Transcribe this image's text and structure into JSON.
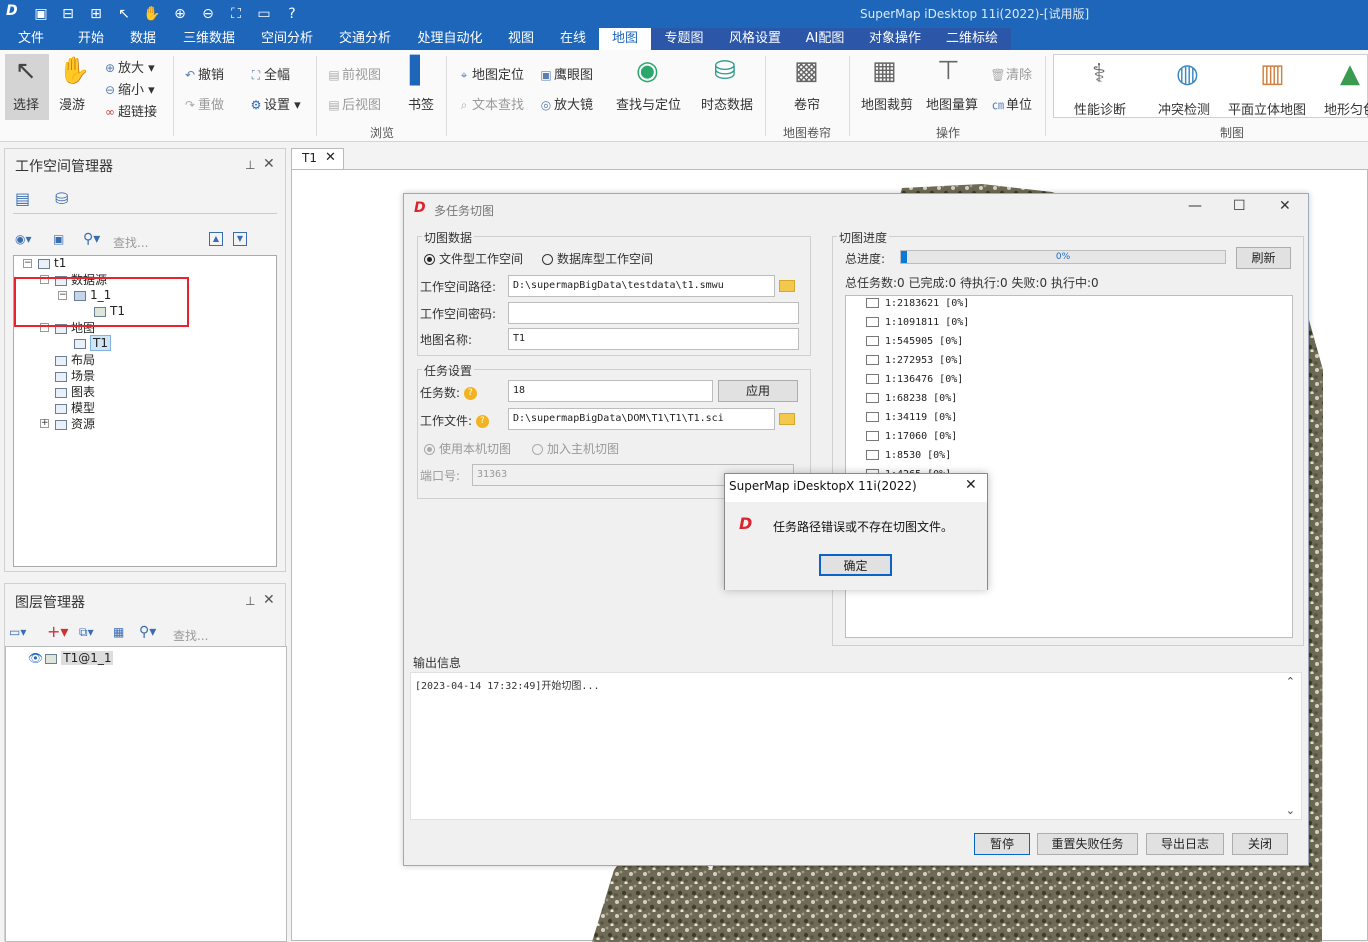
{
  "app": {
    "title": "SuperMap iDesktop 11i(2022)-[试用版]"
  },
  "menu": [
    "文件",
    "开始",
    "数据",
    "三维数据",
    "空间分析",
    "交通分析",
    "处理自动化",
    "视图",
    "在线",
    "地图",
    "专题图",
    "风格设置",
    "AI配图",
    "对象操作",
    "二维标绘"
  ],
  "ribbon": {
    "select": "选择",
    "pan": "漫游",
    "zoomin": "放大",
    "zoomout": "缩小",
    "hyperlink": "超链接",
    "undo": "撤销",
    "redo": "重做",
    "fullextent": "全幅",
    "settings": "设置",
    "prevview": "前视图",
    "nextview": "后视图",
    "bookmark": "书签",
    "maplocate": "地图定位",
    "eagleeye": "鹰眼图",
    "textfind": "文本查找",
    "magnifier": "放大镜",
    "findlocate": "查找与定位",
    "temporal": "时态数据",
    "swipe": "卷帘",
    "mapclip": "地图裁剪",
    "mapmeasure": "地图量算",
    "clear": "清除",
    "unit": "单位",
    "perfdiag": "性能诊断",
    "conflict": "冲突检测",
    "planar3d": "平面立体地图",
    "terrain": "地形匀色",
    "groups": {
      "browse": "浏览",
      "swipe": "地图卷帘",
      "operate": "操作",
      "draw": "制图"
    }
  },
  "workspace": {
    "title": "工作空间管理器",
    "search_placeholder": "查找...",
    "tree": {
      "root": "t1",
      "datasources": "数据源",
      "ds1": "1_1",
      "dataset": "T1",
      "maps": "地图",
      "map1": "T1",
      "layouts": "布局",
      "scenes": "场景",
      "charts": "图表",
      "models": "模型",
      "resources": "资源"
    }
  },
  "layers": {
    "title": "图层管理器",
    "search_placeholder": "查找...",
    "item": "T1@1_1"
  },
  "doc_tab": "T1",
  "dialog": {
    "title": "多任务切图",
    "tile_data": "切图数据",
    "file_ws": "文件型工作空间",
    "db_ws": "数据库型工作空间",
    "ws_path_label": "工作空间路径:",
    "ws_path": "D:\\supermapBigData\\testdata\\t1.smwu",
    "ws_pwd_label": "工作空间密码:",
    "map_name_label": "地图名称:",
    "map_name": "T1",
    "task_settings": "任务设置",
    "task_count_label": "任务数:",
    "task_count": "18",
    "apply": "应用",
    "work_file_label": "工作文件:",
    "work_file": "D:\\supermapBigData\\DOM\\T1\\T1\\T1.sci",
    "use_local": "使用本机切图",
    "join_master": "加入主机切图",
    "port_label": "端口号:",
    "port": "31363",
    "progress_title": "切图进度",
    "total_progress_label": "总进度:",
    "progress_value": 0.02,
    "progress_text": "0%",
    "refresh": "刷新",
    "stats": "总任务数:0 已完成:0 待执行:0 失败:0 执行中:0",
    "scales": [
      "1:2183621 [0%]",
      "1:1091811 [0%]",
      "1:545905 [0%]",
      "1:272953 [0%]",
      "1:136476 [0%]",
      "1:68238 [0%]",
      "1:34119 [0%]",
      "1:17060 [0%]",
      "1:8530 [0%]",
      "1:4265 [0%]"
    ],
    "output_title": "输出信息",
    "output_text": "[2023-04-14 17:32:49]开始切图...",
    "pause": "暂停",
    "reset_failed": "重置失败任务",
    "export_log": "导出日志",
    "close": "关闭"
  },
  "msgbox": {
    "title": "SuperMap iDesktopX 11i(2022)",
    "text": "任务路径错误或不存在切图文件。",
    "ok": "确定"
  },
  "colors": {
    "brand": "#1e66b9",
    "highlight": "#e8232d",
    "progress": "#0a7ad8"
  }
}
